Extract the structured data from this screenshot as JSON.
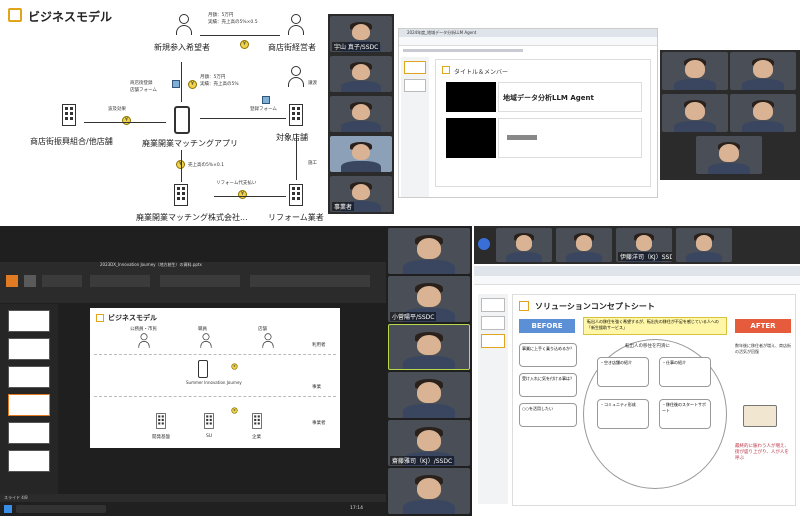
{
  "q1": {
    "title": "ビジネスモデル",
    "actor_new_participant": "新規参入希望者",
    "actor_shop_owner": "商店街経営者",
    "actor_assoc": "商店街振興組合/他店舗",
    "actor_app": "廃業開業マッチングアプリ",
    "actor_company": "廃業開業マッチング株式会社...",
    "actor_target_store": "対象店舗",
    "actor_reform": "リフォーム業者",
    "note_monthly": "月額：5万円",
    "note_success": "実績：売上高の5%×0.5",
    "note_monthly2": "月額：5万円",
    "note_success2": "実績：売上高の5%",
    "note_registration": "商店街登録",
    "note_form": "店舗フォーム",
    "note_ripple": "波及効果",
    "note_sales": "売上高の5%×0.1",
    "note_reform_cost": "リフォーム代支払い",
    "note_sell": "譲渡",
    "note_construct": "施工",
    "note_register_form": "登録フォーム",
    "participants": [
      {
        "name": "宇山 真子/SSDC"
      },
      {
        "name": ""
      },
      {
        "name": ""
      },
      {
        "name": ""
      },
      {
        "name": "事業者"
      }
    ]
  },
  "q2": {
    "tab_title": "2024年度_地域データ分析LLM Agent",
    "slide_heading": "タイトル＆メンバー",
    "slide_title": "地域データ分析LLM Agent",
    "participants": [
      {
        "name": ""
      },
      {
        "name": ""
      },
      {
        "name": ""
      },
      {
        "name": ""
      },
      {
        "name": ""
      }
    ]
  },
  "q3": {
    "app_title": "2023DX_Innovation Journey（地方創生）の資料.pptx",
    "slide_title": "ビジネスモデル",
    "label_public": "公務員・市民",
    "label_employee": "職員",
    "label_store": "店舗",
    "label_user": "利用者",
    "label_business": "事業",
    "label_entity": "事業者",
    "label_app": "Summer Innovation Journey",
    "label_su": "SU",
    "label_company": "企業",
    "label_dev": "開発基盤",
    "status_left": "スライド 4/8",
    "taskbar_time": "17:14"
  },
  "q4": {
    "slide_title": "ソリューションコンセプトシート",
    "before": "BEFORE",
    "after": "AFTER",
    "center_note": "転出人の移住を強く希望するが、転出先の移住が不足を感じている人への「新生援助サービス」",
    "bubble1": "事業に上手く乗り込めるか？",
    "bubble2": "受け入れに気を付ける事は？",
    "bubble3": "○○を活用したい",
    "circle_title": "転出人の移住を円滑に",
    "item_shop": "・空き店舗の紹介",
    "item_work": "・仕事の紹介",
    "item_community": "・コミュニティ形成",
    "item_support": "・移住後のスタートサポート",
    "after_text1": "数年後に移住者が増え、商店街の活気が回復",
    "after_text2": "最終的に賑わう人が増え、街が盛り上がり、人が人を呼ぶ",
    "participants": [
      {
        "name": ""
      },
      {
        "name": "小菅陽平/SSDC"
      },
      {
        "name": ""
      },
      {
        "name": ""
      },
      {
        "name": "齋藤雅司（KJ）/SSDC"
      },
      {
        "name": ""
      },
      {
        "name": ""
      },
      {
        "name": ""
      },
      {
        "name": "伊藤洋司（KJ）SSDC"
      },
      {
        "name": ""
      }
    ]
  }
}
